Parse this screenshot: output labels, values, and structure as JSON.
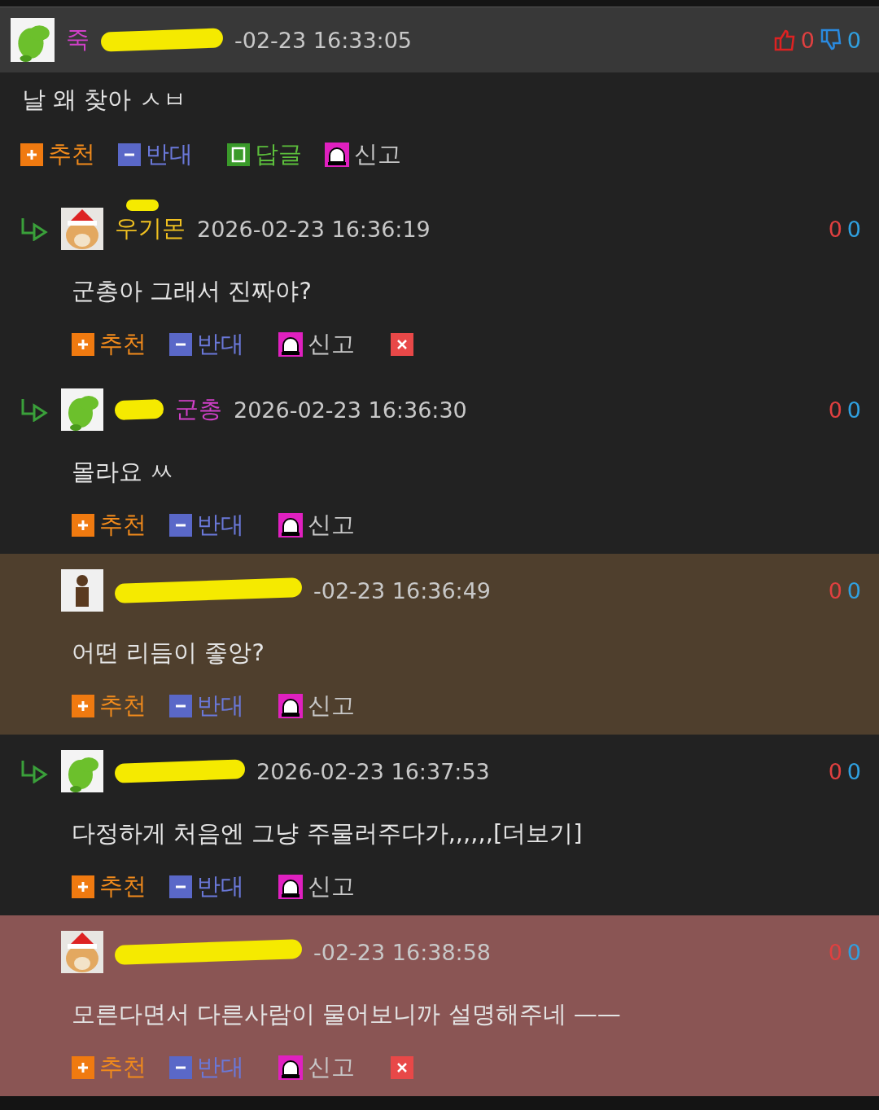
{
  "comments": [
    {
      "kind": "top",
      "name": {
        "text": "죽",
        "color": "#d040c8"
      },
      "redacted": true,
      "redaction": {
        "kind": "after_name"
      },
      "date": "-02-23 16:33:05",
      "likes": "0",
      "dislikes": "0",
      "text": "날 왜 찾아 ㅅㅂ",
      "deletable": false,
      "actions": [
        {
          "kind": "up",
          "label": "추천"
        },
        {
          "kind": "down",
          "label": "반대"
        },
        {
          "kind": "reply",
          "label": "답글"
        },
        {
          "kind": "report",
          "label": "신고"
        }
      ]
    },
    {
      "kind": "reply",
      "reply_arrow": true,
      "name": {
        "text": "우기몬",
        "color": "#f0c020"
      },
      "redacted": true,
      "redaction": {
        "kind": "above_name"
      },
      "date": "2026-02-23 16:36:19",
      "likes": "0",
      "dislikes": "0",
      "text": "군총아 그래서 진짜야?",
      "deletable": true,
      "actions": [
        {
          "kind": "up",
          "label": "추천"
        },
        {
          "kind": "down",
          "label": "반대"
        },
        {
          "kind": "report",
          "label": "신고"
        }
      ]
    },
    {
      "kind": "reply",
      "reply_arrow": true,
      "name": {
        "text": "군총",
        "color": "#d040c8"
      },
      "redacted": true,
      "redaction": {
        "kind": "before_name"
      },
      "date": "2026-02-23 16:36:30",
      "likes": "0",
      "dislikes": "0",
      "text": "몰라요 ㅆ",
      "deletable": false,
      "actions": [
        {
          "kind": "up",
          "label": "추천"
        },
        {
          "kind": "down",
          "label": "반대"
        },
        {
          "kind": "report",
          "label": "신고"
        }
      ]
    },
    {
      "kind": "reply",
      "reply_arrow": false,
      "redacted": true,
      "redaction": {
        "kind": "before_name"
      },
      "date": "-02-23 16:36:49",
      "likes": "0",
      "dislikes": "0",
      "text": "어떤 리듬이 좋앙?",
      "highlight": {
        "color": "#4f3f2d"
      },
      "deletable": false,
      "actions": [
        {
          "kind": "up",
          "label": "추천"
        },
        {
          "kind": "down",
          "label": "반대"
        },
        {
          "kind": "report",
          "label": "신고"
        }
      ]
    },
    {
      "kind": "reply",
      "reply_arrow": true,
      "redacted": true,
      "redaction": {
        "kind": "before_name"
      },
      "date": "2026-02-23 16:37:53",
      "likes": "0",
      "dislikes": "0",
      "text": "다정하게 처음엔 그냥 주물러주다가,,,,,,[더보기]",
      "deletable": false,
      "actions": [
        {
          "kind": "up",
          "label": "추천"
        },
        {
          "kind": "down",
          "label": "반대"
        },
        {
          "kind": "report",
          "label": "신고"
        }
      ]
    },
    {
      "kind": "reply",
      "reply_arrow": false,
      "redacted": true,
      "redaction": {
        "kind": "before_name"
      },
      "date": "-02-23 16:38:58",
      "likes": "0",
      "dislikes": "0",
      "text": "모른다면서 다른사람이 물어보니까 설명해주네 ——",
      "highlight": {
        "color": "#8a5554"
      },
      "deletable": true,
      "actions": [
        {
          "kind": "up",
          "label": "추천"
        },
        {
          "kind": "down",
          "label": "반대"
        },
        {
          "kind": "report",
          "label": "신고"
        }
      ]
    }
  ]
}
